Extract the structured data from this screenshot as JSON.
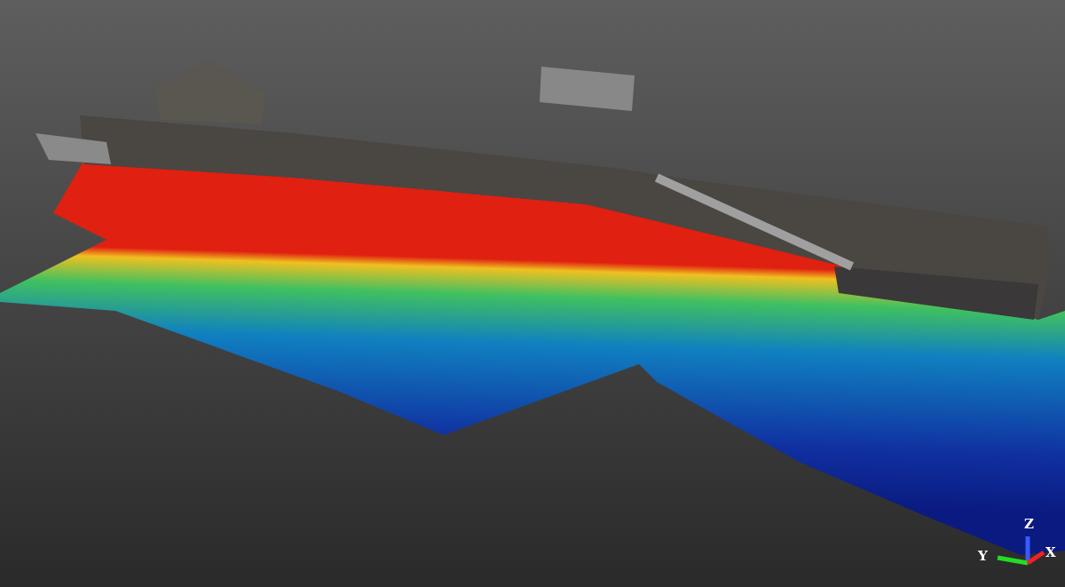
{
  "viewport": {
    "axes": [
      {
        "kind": "z",
        "label": "Z"
      },
      {
        "kind": "y",
        "label": "Y"
      },
      {
        "kind": "x",
        "label": "X"
      }
    ]
  }
}
